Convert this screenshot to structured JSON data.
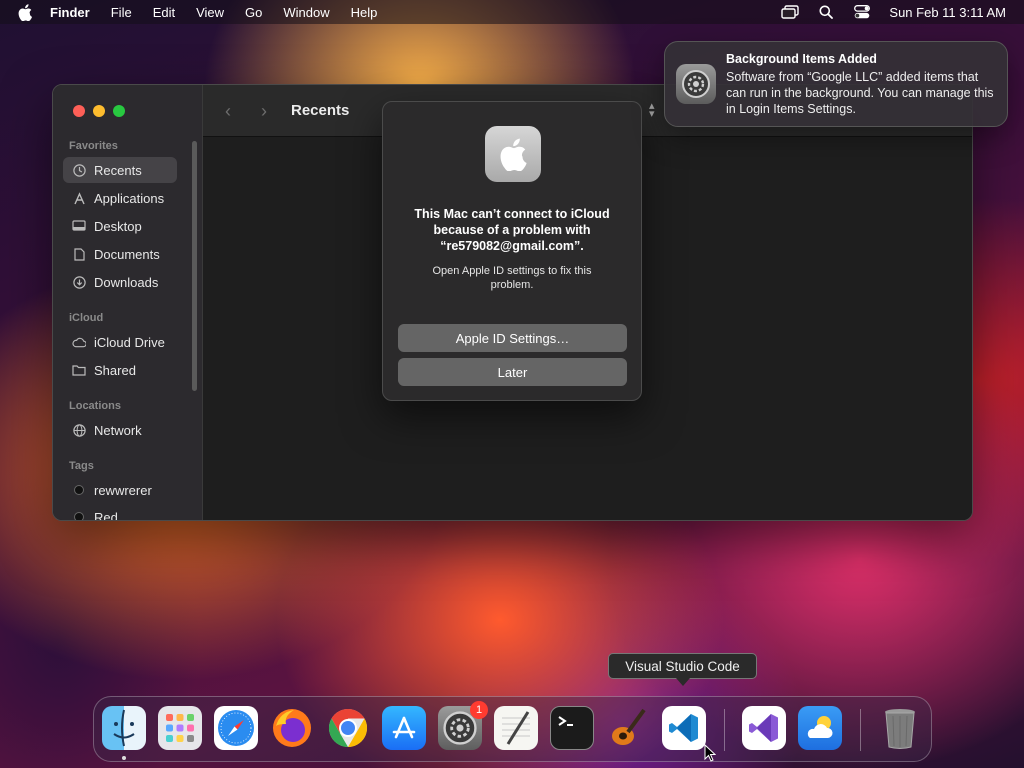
{
  "menubar": {
    "app_name": "Finder",
    "menus": [
      "File",
      "Edit",
      "View",
      "Go",
      "Window",
      "Help"
    ],
    "clock": "Sun Feb 11  3:11 AM",
    "status_icons": [
      "screen-mirroring-icon",
      "spotlight-search-icon",
      "control-center-icon"
    ]
  },
  "finder": {
    "title": "Recents",
    "sidebar": {
      "favorites_header": "Favorites",
      "favorites": [
        {
          "label": "Recents",
          "icon": "clock-icon",
          "active": true
        },
        {
          "label": "Applications",
          "icon": "applications-icon"
        },
        {
          "label": "Desktop",
          "icon": "desktop-icon"
        },
        {
          "label": "Documents",
          "icon": "document-icon"
        },
        {
          "label": "Downloads",
          "icon": "download-icon"
        }
      ],
      "icloud_header": "iCloud",
      "icloud": [
        {
          "label": "iCloud Drive",
          "icon": "cloud-icon"
        },
        {
          "label": "Shared",
          "icon": "shared-folder-icon"
        }
      ],
      "locations_header": "Locations",
      "locations": [
        {
          "label": "Network",
          "icon": "network-icon"
        }
      ],
      "tags_header": "Tags",
      "tags": [
        {
          "label": "rewwrerer"
        },
        {
          "label": "Red"
        }
      ]
    }
  },
  "dialog": {
    "headline": "This Mac can’t connect to iCloud because of a problem with “re579082@gmail.com”.",
    "body": "Open Apple ID settings to fix this problem.",
    "primary_button": "Apple ID Settings…",
    "secondary_button": "Later"
  },
  "notification": {
    "title": "Background Items Added",
    "body": "Software from “Google LLC” added items that can run in the background. You can manage this in Login Items Settings."
  },
  "tooltip": "Visual Studio Code",
  "dock": {
    "apps": [
      {
        "name": "Finder",
        "icon": "finder-icon",
        "running": true
      },
      {
        "name": "Launchpad",
        "icon": "launchpad-icon"
      },
      {
        "name": "Safari",
        "icon": "safari-icon"
      },
      {
        "name": "Firefox",
        "icon": "firefox-icon"
      },
      {
        "name": "Google Chrome",
        "icon": "chrome-icon"
      },
      {
        "name": "App Store",
        "icon": "app-store-icon"
      },
      {
        "name": "System Settings",
        "icon": "system-settings-icon",
        "badge": "1"
      },
      {
        "name": "TextEdit",
        "icon": "textedit-icon"
      },
      {
        "name": "Terminal",
        "icon": "terminal-icon"
      },
      {
        "name": "GarageBand",
        "icon": "garageband-icon"
      },
      {
        "name": "Visual Studio Code",
        "icon": "vscode-icon"
      },
      {
        "name": "Visual Studio",
        "icon": "visual-studio-icon"
      },
      {
        "name": "Weather",
        "icon": "weather-icon"
      },
      {
        "name": "Trash",
        "icon": "trash-icon"
      }
    ]
  },
  "colors": {
    "dialog_button": "#656565",
    "badge_red": "#ff3b30",
    "traffic_red": "#fe5f57",
    "traffic_yellow": "#febc2e",
    "traffic_green": "#28c840"
  }
}
